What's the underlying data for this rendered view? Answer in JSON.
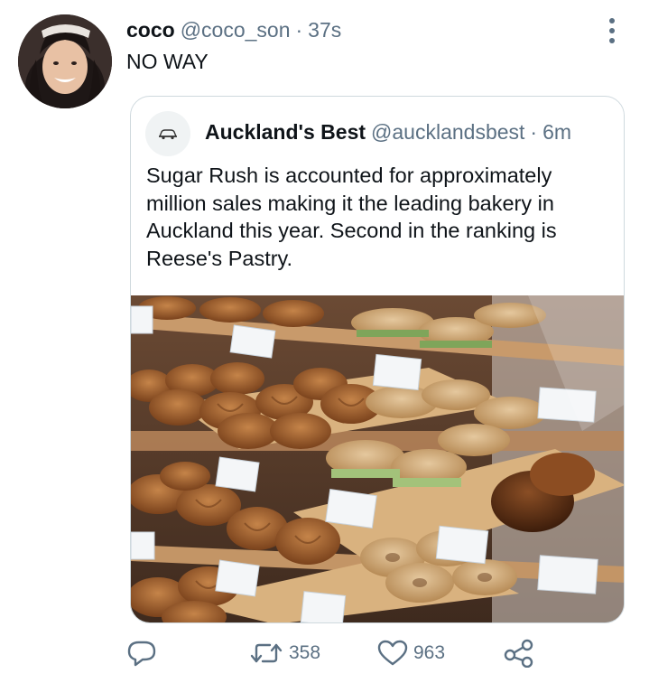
{
  "author": {
    "display_name": "coco",
    "handle": "@coco_son",
    "separator": "·",
    "time": "37s"
  },
  "tweet": {
    "text": "NO WAY"
  },
  "quoted": {
    "display_name": "Auckland's Best",
    "handle": "@aucklandsbest",
    "separator": "·",
    "time": "6m",
    "text": "Sugar Rush is accounted for approximately million sales making it the leading bakery in Auckland this year. Second in the ranking is Reese's Pastry.",
    "image_icon": "bakery-pastry-display-photo"
  },
  "actions": {
    "reply_icon": "reply-icon",
    "retweet_count": "358",
    "like_count": "963",
    "share_icon": "share-icon"
  },
  "colors": {
    "text_primary": "#0f1419",
    "text_secondary": "#5b7083",
    "border": "#cfd9de"
  }
}
